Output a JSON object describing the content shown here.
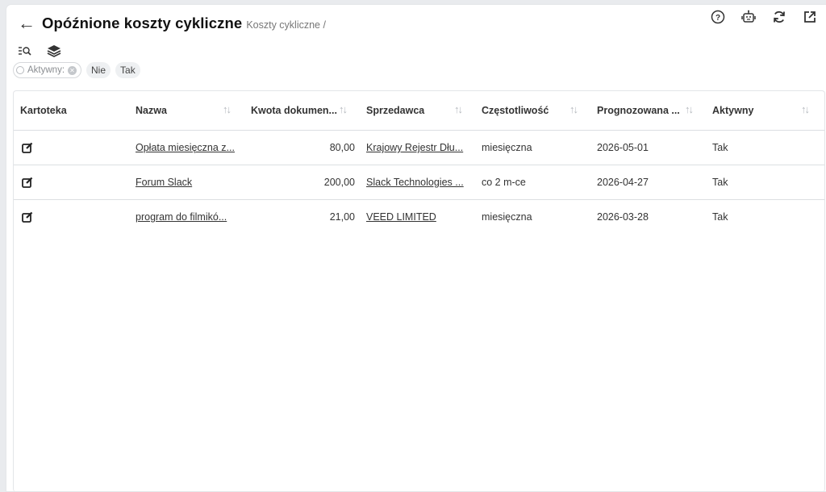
{
  "header": {
    "title": "Opóźnione koszty cykliczne",
    "breadcrumb": "Koszty cykliczne /"
  },
  "filters": {
    "label": "Aktywny:",
    "options": [
      "Nie",
      "Tak"
    ]
  },
  "table": {
    "columns": [
      "Kartoteka",
      "Nazwa",
      "Kwota dokumen...",
      "Sprzedawca",
      "Częstotliwość",
      "Prognozowana ...",
      "Aktywny"
    ],
    "rows": [
      {
        "nazwa": "Opłata miesięczna z...",
        "kwota": "80,00",
        "sprzedawca": "Krajowy Rejestr Dłu...",
        "czestotliwosc": "miesięczna",
        "prognoza": "2026-05-01",
        "aktywny": "Tak"
      },
      {
        "nazwa": "Forum Slack",
        "kwota": "200,00",
        "sprzedawca": "Slack Technologies ...",
        "czestotliwosc": "co 2 m-ce",
        "prognoza": "2026-04-27",
        "aktywny": "Tak"
      },
      {
        "nazwa": "program do filmikó...",
        "kwota": "21,00",
        "sprzedawca": "VEED LIMITED",
        "czestotliwosc": "miesięczna",
        "prognoza": "2026-03-28",
        "aktywny": "Tak"
      }
    ]
  },
  "icons": [
    "back-arrow-icon",
    "help-icon",
    "robot-icon",
    "refresh-icon",
    "external-link-icon",
    "search-list-icon",
    "layers-icon",
    "edit-icon",
    "sort-icon"
  ]
}
